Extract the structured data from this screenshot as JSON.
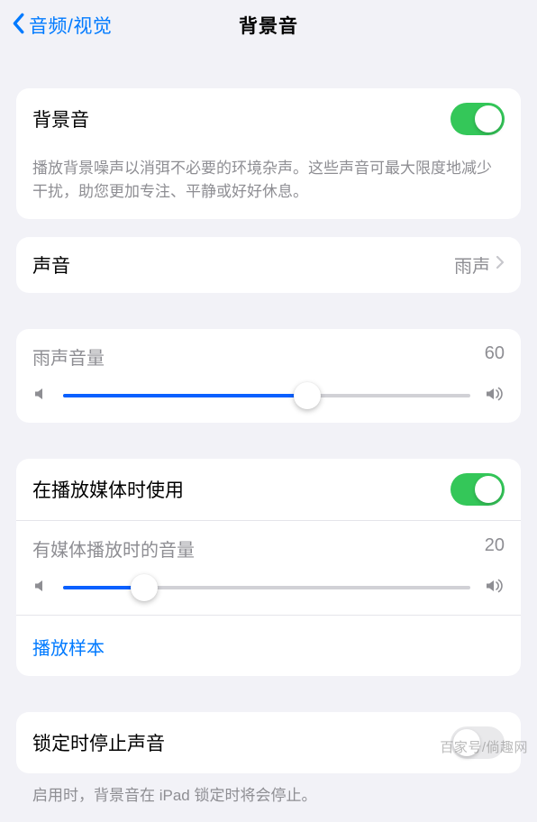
{
  "nav": {
    "back_label": "音频/视觉",
    "title": "背景音"
  },
  "main_toggle": {
    "label": "背景音",
    "on": true
  },
  "main_footer": "播放背景噪声以消弭不必要的环境杂声。这些声音可最大限度地减少干扰，助您更加专注、平静或好好休息。",
  "sound_row": {
    "label": "声音",
    "value": "雨声"
  },
  "volume1": {
    "label": "雨声音量",
    "value": 60
  },
  "media": {
    "toggle_label": "在播放媒体时使用",
    "toggle_on": true,
    "vol_label": "有媒体播放时的音量",
    "vol_value": 20,
    "sample_link": "播放样本"
  },
  "lock": {
    "label": "锁定时停止声音",
    "on": false,
    "footer": "启用时，背景音在 iPad 锁定时将会停止。"
  },
  "watermark": "百家号/倘趣网"
}
